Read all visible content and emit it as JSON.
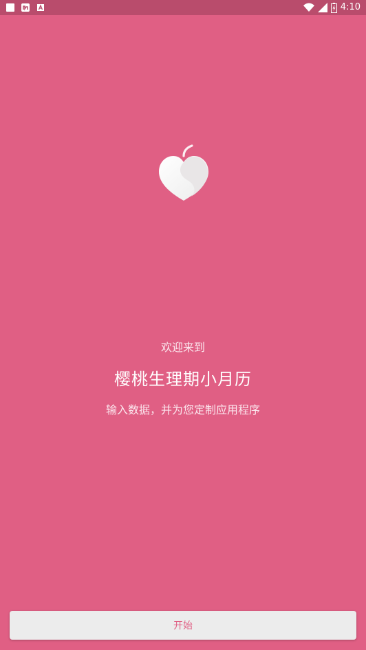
{
  "status_bar": {
    "time": "4:10",
    "left_icons": [
      "notification-square-icon",
      "app-notification-icon",
      "text-a-icon"
    ],
    "right_icons": [
      "wifi-icon",
      "signal-icon",
      "battery-icon"
    ]
  },
  "splash": {
    "logo_icon": "peach-heart-logo-icon",
    "welcome": "欢迎来到",
    "app_name": "樱桃生理期小月历",
    "tagline": "输入数据，并为您定制应用程序"
  },
  "actions": {
    "start_label": "开始"
  },
  "colors": {
    "background": "#e05f84",
    "status_bar": "#b94c6c",
    "button_bg": "#ececec",
    "button_text": "#e05f84"
  }
}
